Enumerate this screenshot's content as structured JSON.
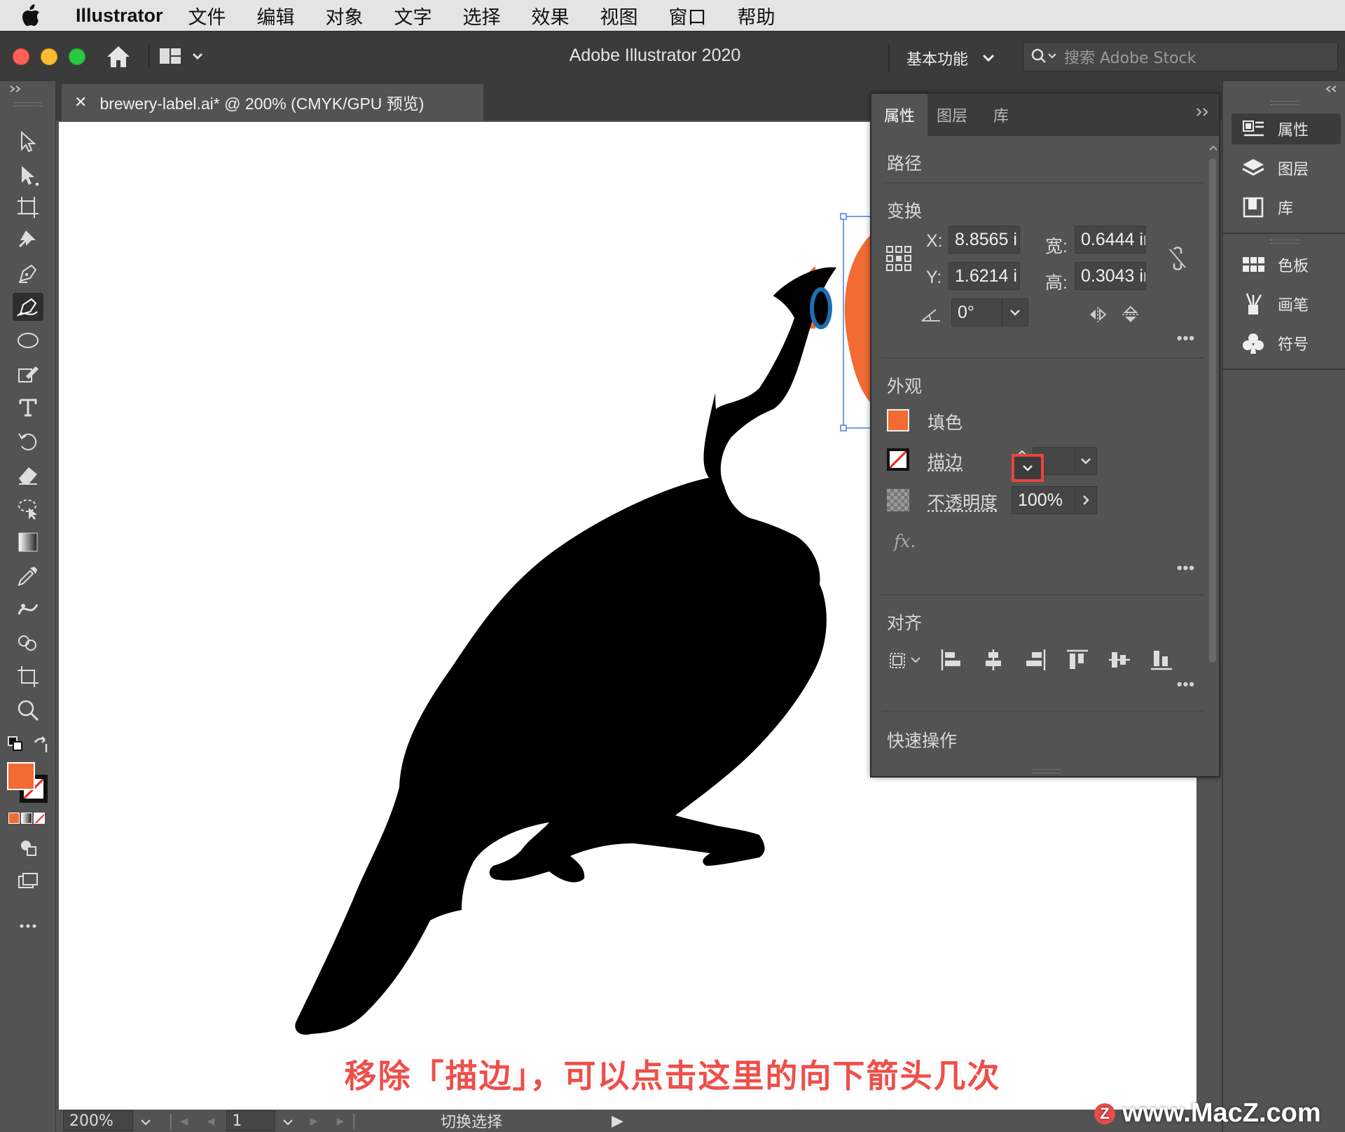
{
  "menubar": {
    "app_name": "Illustrator",
    "items": [
      "文件",
      "编辑",
      "对象",
      "文字",
      "选择",
      "效果",
      "视图",
      "窗口",
      "帮助"
    ]
  },
  "titlebar": {
    "title": "Adobe Illustrator 2020",
    "workspace": "基本功能",
    "search_placeholder": "搜索 Adobe Stock"
  },
  "document": {
    "tab_title": "brewery-label.ai* @ 200% (CMYK/GPU 预览)"
  },
  "properties_panel": {
    "tabs": [
      "属性",
      "图层",
      "库"
    ],
    "object_type": "路径",
    "transform": {
      "title": "变换",
      "x_label": "X:",
      "x_value": "8.8565 i",
      "y_label": "Y:",
      "y_value": "1.6214 i",
      "w_label": "宽:",
      "w_value": "0.6444 ir",
      "h_label": "高:",
      "h_value": "0.3043 ir",
      "angle_value": "0°"
    },
    "appearance": {
      "title": "外观",
      "fill_label": "填色",
      "stroke_label": "描边",
      "opacity_label": "不透明度",
      "opacity_value": "100%",
      "fx_label": "fx."
    },
    "align": {
      "title": "对齐"
    },
    "quick_actions": {
      "title": "快速操作"
    }
  },
  "right_dock": {
    "items": [
      "属性",
      "图层",
      "库",
      "色板",
      "画笔",
      "符号"
    ]
  },
  "statusbar": {
    "zoom": "200%",
    "page": "1",
    "label": "切换选择"
  },
  "overlay": {
    "caption": "移除「描边」，可以点击这里的向下箭头几次",
    "watermark": "www.MacZ.com",
    "watermark_badge": "Z"
  },
  "colors": {
    "fill": "#f26b33",
    "bird_eye": "#1f6fb0",
    "highlight": "#e8453c",
    "caption": "#ee4f4a"
  }
}
